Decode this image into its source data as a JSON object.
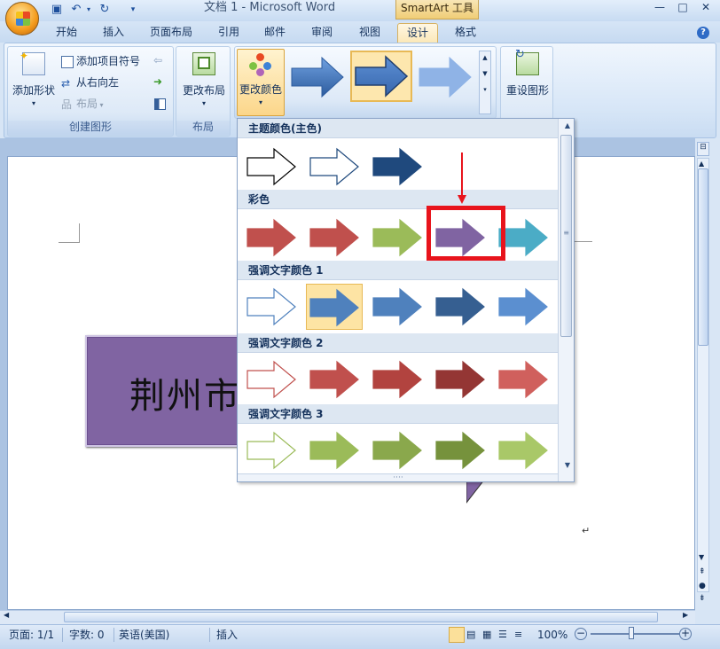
{
  "window": {
    "title": "文档 1 - Microsoft Word",
    "context_tab": "SmartArt 工具",
    "controls": {
      "minimize": "—",
      "maximize": "□",
      "close": "✕"
    },
    "help": "?"
  },
  "tabs": [
    {
      "label": "开始"
    },
    {
      "label": "插入"
    },
    {
      "label": "页面布局"
    },
    {
      "label": "引用"
    },
    {
      "label": "邮件"
    },
    {
      "label": "审阅"
    },
    {
      "label": "视图"
    },
    {
      "label": "设计",
      "active": true
    },
    {
      "label": "格式"
    }
  ],
  "ribbon": {
    "create_group": {
      "label": "创建图形",
      "add_shape": "添加形状",
      "add_bullet": "添加项目符号",
      "right_to_left": "从右向左",
      "layout": "布局"
    },
    "layout_group": {
      "label": "布局",
      "change_layout": "更改布局"
    },
    "styles_group": {
      "change_colors": "更改颜色"
    },
    "reset_group": {
      "reset_graphic": "重设图形"
    }
  },
  "gallery": {
    "sections": [
      {
        "title": "主题颜色(主色)",
        "arrows": [
          {
            "fill": "#ffffff",
            "stroke": "#000000"
          },
          {
            "fill": "#ffffff",
            "stroke": "#1f497d"
          },
          {
            "fill": "#1f497d",
            "stroke": "#1f497d"
          }
        ]
      },
      {
        "title": "彩色",
        "arrows": [
          {
            "fill": "#c0504d",
            "stroke": "#c0504d"
          },
          {
            "fill": "#c0504d",
            "stroke": "#c0504d"
          },
          {
            "fill": "#9bbb59",
            "stroke": "#9bbb59"
          },
          {
            "fill": "#8064a2",
            "stroke": "#8064a2",
            "highlighted": true
          },
          {
            "fill": "#4bacc6",
            "stroke": "#4bacc6"
          }
        ]
      },
      {
        "title": "强调文字颜色 1",
        "arrows": [
          {
            "fill": "#ffffff",
            "stroke": "#4f81bd"
          },
          {
            "fill": "#4f81bd",
            "stroke": "#4f81bd",
            "selected": true
          },
          {
            "fill": "#4f81bd",
            "stroke": "#4f81bd"
          },
          {
            "fill": "#365f91",
            "stroke": "#365f91"
          },
          {
            "fill": "#5b8fd0",
            "stroke": "#5b8fd0"
          }
        ]
      },
      {
        "title": "强调文字颜色 2",
        "arrows": [
          {
            "fill": "#ffffff",
            "stroke": "#c0504d"
          },
          {
            "fill": "#c0504d",
            "stroke": "#c0504d"
          },
          {
            "fill": "#b2433f",
            "stroke": "#b2433f"
          },
          {
            "fill": "#943634",
            "stroke": "#943634"
          },
          {
            "fill": "#d0605d",
            "stroke": "#d0605d"
          }
        ]
      },
      {
        "title": "强调文字颜色 3",
        "arrows": [
          {
            "fill": "#ffffff",
            "stroke": "#9bbb59"
          },
          {
            "fill": "#9bbb59",
            "stroke": "#9bbb59"
          },
          {
            "fill": "#8aa84c",
            "stroke": "#8aa84c"
          },
          {
            "fill": "#76923c",
            "stroke": "#76923c"
          },
          {
            "fill": "#a9c868",
            "stroke": "#a9c868"
          }
        ]
      }
    ],
    "resize_grip": "····"
  },
  "document": {
    "smartart_text": "荆州市",
    "paragraph_mark": "↵"
  },
  "status": {
    "page": "页面: 1/1",
    "words": "字数: 0",
    "language": "英语(美国)",
    "mode": "插入",
    "zoom": "100%"
  },
  "colors": {
    "accent_purple": "#8064a2",
    "highlight_red": "#e8141c"
  }
}
